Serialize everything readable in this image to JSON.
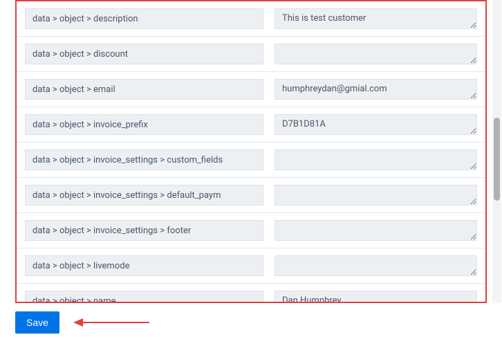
{
  "rows": [
    {
      "label": "data > object > description",
      "value": "This is test customer"
    },
    {
      "label": "data > object > discount",
      "value": ""
    },
    {
      "label": "data > object > email",
      "value": "humphreydan@gmial.com"
    },
    {
      "label": "data > object > invoice_prefix",
      "value": "D7B1D81A"
    },
    {
      "label": "data > object > invoice_settings > custom_fields",
      "value": ""
    },
    {
      "label": "data > object > invoice_settings > default_paym",
      "value": ""
    },
    {
      "label": "data > object > invoice_settings > footer",
      "value": ""
    },
    {
      "label": "data > object > livemode",
      "value": ""
    },
    {
      "label": "data > object > name",
      "value": "Dan Humphrey"
    }
  ],
  "buttons": {
    "save": "Save"
  }
}
